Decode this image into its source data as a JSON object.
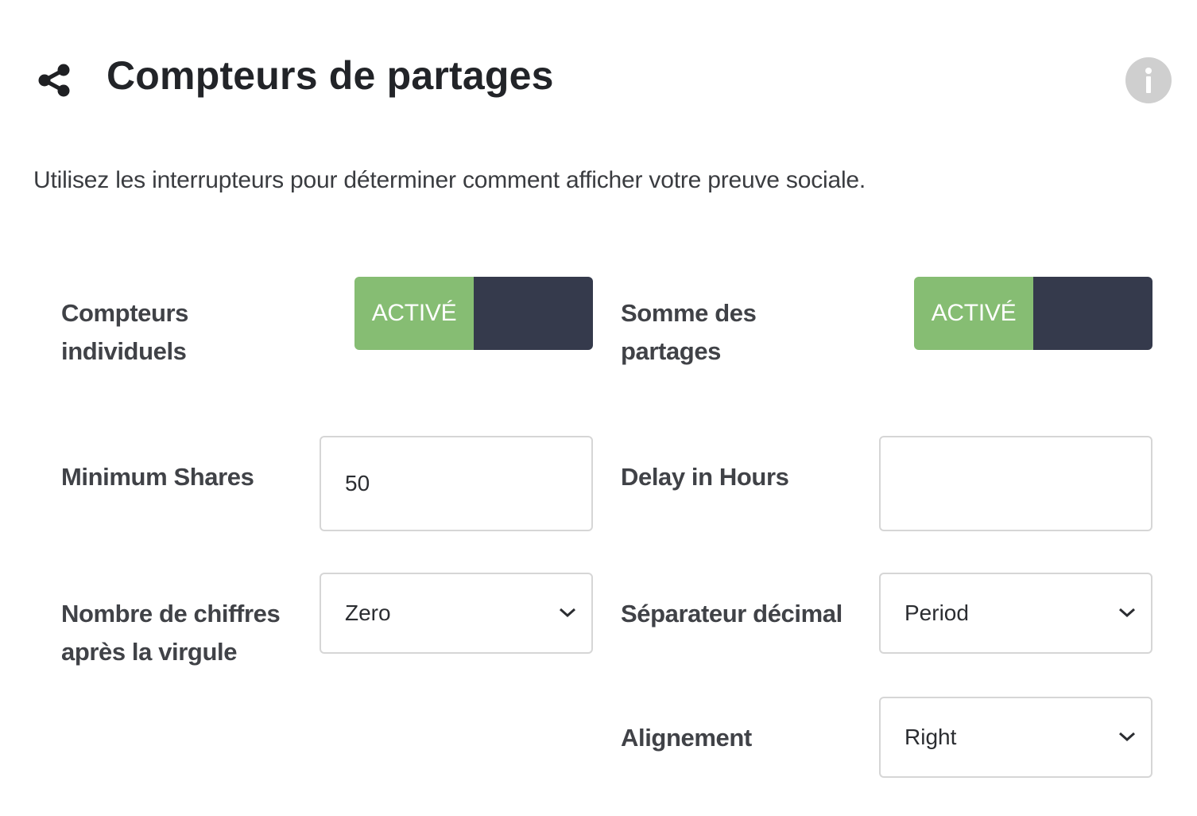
{
  "header": {
    "title": "Compteurs de partages",
    "icon": "share-icon",
    "info_icon": "info-icon"
  },
  "description": "Utilisez les interrupteurs pour déterminer comment afficher votre preuve sociale.",
  "fields": {
    "individual_counters": {
      "label_line1": "Compteurs",
      "label_line2": "individuels",
      "toggle_label": "ACTIVÉ",
      "state": "on"
    },
    "total_shares": {
      "label_line1": "Somme des",
      "label_line2": "partages",
      "toggle_label": "ACTIVÉ",
      "state": "on"
    },
    "minimum_shares": {
      "label": "Minimum Shares",
      "value": "50"
    },
    "delay_hours": {
      "label": "Delay in Hours",
      "value": ""
    },
    "decimals": {
      "label_line1": "Nombre de chiffres",
      "label_line2": "après la virgule",
      "selected": "Zero"
    },
    "decimal_separator": {
      "label": "Séparateur décimal",
      "selected": "Period"
    },
    "alignment": {
      "label": "Alignement",
      "selected": "Right"
    }
  },
  "colors": {
    "toggle_on": "#86bd73",
    "toggle_off": "#353a4c",
    "info_bg": "#cfcfcf",
    "input_border": "#d6d6d6"
  }
}
